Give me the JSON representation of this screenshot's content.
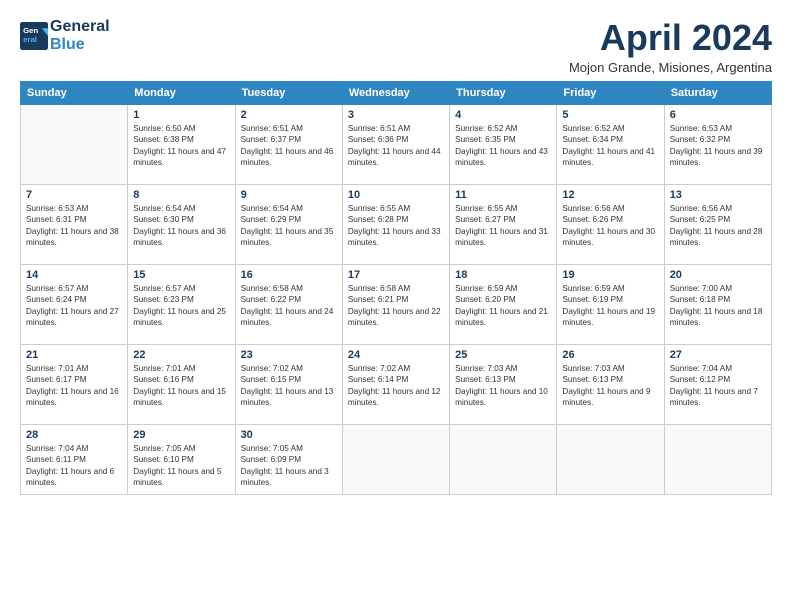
{
  "logo": {
    "line1": "General",
    "line2": "Blue"
  },
  "title": "April 2024",
  "subtitle": "Mojon Grande, Misiones, Argentina",
  "days_of_week": [
    "Sunday",
    "Monday",
    "Tuesday",
    "Wednesday",
    "Thursday",
    "Friday",
    "Saturday"
  ],
  "weeks": [
    [
      {
        "num": "",
        "sunrise": "",
        "sunset": "",
        "daylight": ""
      },
      {
        "num": "1",
        "sunrise": "Sunrise: 6:50 AM",
        "sunset": "Sunset: 6:38 PM",
        "daylight": "Daylight: 11 hours and 47 minutes."
      },
      {
        "num": "2",
        "sunrise": "Sunrise: 6:51 AM",
        "sunset": "Sunset: 6:37 PM",
        "daylight": "Daylight: 11 hours and 46 minutes."
      },
      {
        "num": "3",
        "sunrise": "Sunrise: 6:51 AM",
        "sunset": "Sunset: 6:36 PM",
        "daylight": "Daylight: 11 hours and 44 minutes."
      },
      {
        "num": "4",
        "sunrise": "Sunrise: 6:52 AM",
        "sunset": "Sunset: 6:35 PM",
        "daylight": "Daylight: 11 hours and 43 minutes."
      },
      {
        "num": "5",
        "sunrise": "Sunrise: 6:52 AM",
        "sunset": "Sunset: 6:34 PM",
        "daylight": "Daylight: 11 hours and 41 minutes."
      },
      {
        "num": "6",
        "sunrise": "Sunrise: 6:53 AM",
        "sunset": "Sunset: 6:32 PM",
        "daylight": "Daylight: 11 hours and 39 minutes."
      }
    ],
    [
      {
        "num": "7",
        "sunrise": "Sunrise: 6:53 AM",
        "sunset": "Sunset: 6:31 PM",
        "daylight": "Daylight: 11 hours and 38 minutes."
      },
      {
        "num": "8",
        "sunrise": "Sunrise: 6:54 AM",
        "sunset": "Sunset: 6:30 PM",
        "daylight": "Daylight: 11 hours and 36 minutes."
      },
      {
        "num": "9",
        "sunrise": "Sunrise: 6:54 AM",
        "sunset": "Sunset: 6:29 PM",
        "daylight": "Daylight: 11 hours and 35 minutes."
      },
      {
        "num": "10",
        "sunrise": "Sunrise: 6:55 AM",
        "sunset": "Sunset: 6:28 PM",
        "daylight": "Daylight: 11 hours and 33 minutes."
      },
      {
        "num": "11",
        "sunrise": "Sunrise: 6:55 AM",
        "sunset": "Sunset: 6:27 PM",
        "daylight": "Daylight: 11 hours and 31 minutes."
      },
      {
        "num": "12",
        "sunrise": "Sunrise: 6:56 AM",
        "sunset": "Sunset: 6:26 PM",
        "daylight": "Daylight: 11 hours and 30 minutes."
      },
      {
        "num": "13",
        "sunrise": "Sunrise: 6:56 AM",
        "sunset": "Sunset: 6:25 PM",
        "daylight": "Daylight: 11 hours and 28 minutes."
      }
    ],
    [
      {
        "num": "14",
        "sunrise": "Sunrise: 6:57 AM",
        "sunset": "Sunset: 6:24 PM",
        "daylight": "Daylight: 11 hours and 27 minutes."
      },
      {
        "num": "15",
        "sunrise": "Sunrise: 6:57 AM",
        "sunset": "Sunset: 6:23 PM",
        "daylight": "Daylight: 11 hours and 25 minutes."
      },
      {
        "num": "16",
        "sunrise": "Sunrise: 6:58 AM",
        "sunset": "Sunset: 6:22 PM",
        "daylight": "Daylight: 11 hours and 24 minutes."
      },
      {
        "num": "17",
        "sunrise": "Sunrise: 6:58 AM",
        "sunset": "Sunset: 6:21 PM",
        "daylight": "Daylight: 11 hours and 22 minutes."
      },
      {
        "num": "18",
        "sunrise": "Sunrise: 6:59 AM",
        "sunset": "Sunset: 6:20 PM",
        "daylight": "Daylight: 11 hours and 21 minutes."
      },
      {
        "num": "19",
        "sunrise": "Sunrise: 6:59 AM",
        "sunset": "Sunset: 6:19 PM",
        "daylight": "Daylight: 11 hours and 19 minutes."
      },
      {
        "num": "20",
        "sunrise": "Sunrise: 7:00 AM",
        "sunset": "Sunset: 6:18 PM",
        "daylight": "Daylight: 11 hours and 18 minutes."
      }
    ],
    [
      {
        "num": "21",
        "sunrise": "Sunrise: 7:01 AM",
        "sunset": "Sunset: 6:17 PM",
        "daylight": "Daylight: 11 hours and 16 minutes."
      },
      {
        "num": "22",
        "sunrise": "Sunrise: 7:01 AM",
        "sunset": "Sunset: 6:16 PM",
        "daylight": "Daylight: 11 hours and 15 minutes."
      },
      {
        "num": "23",
        "sunrise": "Sunrise: 7:02 AM",
        "sunset": "Sunset: 6:15 PM",
        "daylight": "Daylight: 11 hours and 13 minutes."
      },
      {
        "num": "24",
        "sunrise": "Sunrise: 7:02 AM",
        "sunset": "Sunset: 6:14 PM",
        "daylight": "Daylight: 11 hours and 12 minutes."
      },
      {
        "num": "25",
        "sunrise": "Sunrise: 7:03 AM",
        "sunset": "Sunset: 6:13 PM",
        "daylight": "Daylight: 11 hours and 10 minutes."
      },
      {
        "num": "26",
        "sunrise": "Sunrise: 7:03 AM",
        "sunset": "Sunset: 6:13 PM",
        "daylight": "Daylight: 11 hours and 9 minutes."
      },
      {
        "num": "27",
        "sunrise": "Sunrise: 7:04 AM",
        "sunset": "Sunset: 6:12 PM",
        "daylight": "Daylight: 11 hours and 7 minutes."
      }
    ],
    [
      {
        "num": "28",
        "sunrise": "Sunrise: 7:04 AM",
        "sunset": "Sunset: 6:11 PM",
        "daylight": "Daylight: 11 hours and 6 minutes."
      },
      {
        "num": "29",
        "sunrise": "Sunrise: 7:05 AM",
        "sunset": "Sunset: 6:10 PM",
        "daylight": "Daylight: 11 hours and 5 minutes."
      },
      {
        "num": "30",
        "sunrise": "Sunrise: 7:05 AM",
        "sunset": "Sunset: 6:09 PM",
        "daylight": "Daylight: 11 hours and 3 minutes."
      },
      {
        "num": "",
        "sunrise": "",
        "sunset": "",
        "daylight": ""
      },
      {
        "num": "",
        "sunrise": "",
        "sunset": "",
        "daylight": ""
      },
      {
        "num": "",
        "sunrise": "",
        "sunset": "",
        "daylight": ""
      },
      {
        "num": "",
        "sunrise": "",
        "sunset": "",
        "daylight": ""
      }
    ]
  ]
}
